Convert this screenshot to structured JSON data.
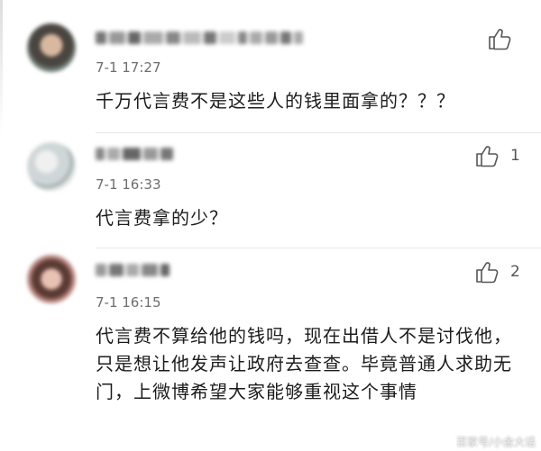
{
  "comments": [
    {
      "time": "7-1 17:27",
      "text": "千万代言费不是这些人的钱里面拿的？？？",
      "likes": ""
    },
    {
      "time": "7-1 16:33",
      "text": "代言费拿的少？",
      "likes": "1"
    },
    {
      "time": "7-1 16:15",
      "text": "代言费不算给他的钱吗，现在出借人不是讨伐他，只是想让他发声让政府去查查。毕竟普通人求助无门，上微博希望大家能够重视这个事情",
      "likes": "2"
    }
  ],
  "watermark": "百家号/小金大话",
  "icons": {
    "like": "thumbs-up-icon"
  },
  "colors": {
    "text": "#1c1c1c",
    "time": "#6e6e6e",
    "divider": "#e6e6e6"
  }
}
